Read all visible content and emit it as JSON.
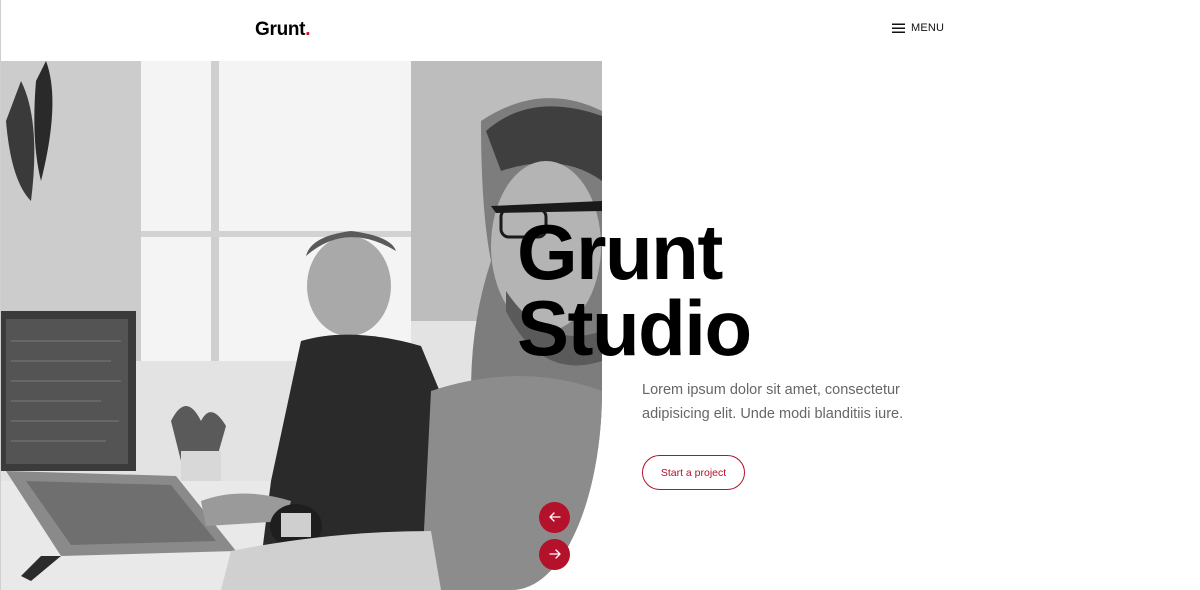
{
  "header": {
    "logo_text": "Grunt",
    "logo_dot": ".",
    "menu_icon": "hamburger-icon",
    "menu_label": "MENU"
  },
  "hero": {
    "image_alt": "Two men working at computers in a bright office, black and white photo",
    "title_line1": "Grunt",
    "title_line2": "Studio",
    "description": "Lorem ipsum dolor sit amet, consectetur adipisicing elit. Unde modi blanditiis iure.",
    "cta_label": "Start a project"
  },
  "slider": {
    "prev_icon": "arrow-left-icon",
    "next_icon": "arrow-right-icon"
  },
  "colors": {
    "accent": "#b3122a",
    "text": "#000000",
    "muted": "#666666",
    "background": "#ffffff"
  }
}
